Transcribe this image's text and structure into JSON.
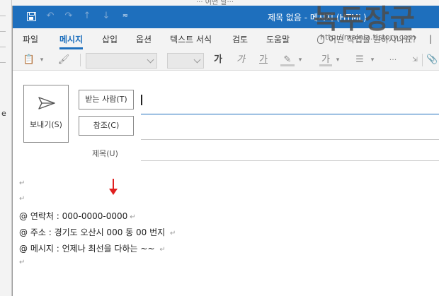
{
  "background": {
    "left_char": "e",
    "top_hint": "··· 어떤 날···"
  },
  "window": {
    "title": "제목 없음 - 메시지 (HTML)"
  },
  "tabs": [
    {
      "label": "파일",
      "active": false
    },
    {
      "label": "메시지",
      "active": true
    },
    {
      "label": "삽입",
      "active": false
    },
    {
      "label": "옵션",
      "active": false
    },
    {
      "label": "텍스트 서식",
      "active": false
    },
    {
      "label": "검토",
      "active": false
    },
    {
      "label": "도움말",
      "active": false
    }
  ],
  "tell_me": {
    "placeholder": "어떤 작업을 원하시나요?"
  },
  "ribbon": {
    "bold": "가",
    "italic": "가",
    "underline": "가",
    "font_color": "가"
  },
  "header": {
    "send_label": "보내기(S)",
    "to_label": "받는 사람(T)",
    "cc_label": "참조(C)",
    "subject_label": "제목(U)"
  },
  "body": {
    "lines": [
      "@ 연락처 : 000-0000-0000",
      "@ 주소 : 경기도 오산시 000 동 00 번지 ",
      "@ 메시지 : 언제나 최선을 다하는 ~~ "
    ],
    "paragraph_mark": "↵"
  },
  "watermark": {
    "text": "녹두장군",
    "url": "http://mainia.tistory.com"
  },
  "colors": {
    "accent": "#1e6fbd",
    "arrow": "#e02020"
  }
}
